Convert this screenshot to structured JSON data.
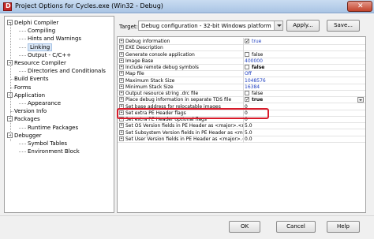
{
  "window": {
    "title": "Project Options for Cycles.exe  (Win32 - Debug)",
    "close_glyph": "✕",
    "icon_glyph": "D"
  },
  "tree": {
    "items": [
      {
        "label": "Delphi Compiler",
        "level": 0,
        "expander": "−"
      },
      {
        "label": "Compiling",
        "level": 1
      },
      {
        "label": "Hints and Warnings",
        "level": 1
      },
      {
        "label": "Linking",
        "level": 1,
        "selected": true
      },
      {
        "label": "Output - C/C++",
        "level": 1
      },
      {
        "label": "Resource Compiler",
        "level": 0,
        "expander": "−"
      },
      {
        "label": "Directories and Conditionals",
        "level": 1
      },
      {
        "label": "Build Events",
        "level": 0
      },
      {
        "label": "Forms",
        "level": 0
      },
      {
        "label": "Application",
        "level": 0,
        "expander": "−"
      },
      {
        "label": "Appearance",
        "level": 1
      },
      {
        "label": "Version Info",
        "level": 0
      },
      {
        "label": "Packages",
        "level": 0,
        "expander": "−"
      },
      {
        "label": "Runtime Packages",
        "level": 1
      },
      {
        "label": "Debugger",
        "level": 0,
        "expander": "−"
      },
      {
        "label": "Symbol Tables",
        "level": 1
      },
      {
        "label": "Environment Block",
        "level": 1
      }
    ]
  },
  "target": {
    "label": "Target:",
    "value": "Debug configuration - 32-bit Windows platform",
    "apply_button": "Apply...",
    "save_button": "Save..."
  },
  "properties": [
    {
      "name": "Debug information",
      "value": "true",
      "check": true,
      "checked": true,
      "style": "blue"
    },
    {
      "name": "EXE Description",
      "value": ""
    },
    {
      "name": "Generate console application",
      "value": "false",
      "check": true,
      "checked": false
    },
    {
      "name": "Image Base",
      "value": "400000",
      "style": "blue"
    },
    {
      "name": "Include remote debug symbols",
      "value": "false",
      "check": true,
      "checked": false,
      "style": "bold"
    },
    {
      "name": "Map file",
      "value": "Off",
      "style": "blue"
    },
    {
      "name": "Maximum Stack Size",
      "value": "1048576",
      "style": "blue"
    },
    {
      "name": "Minimum Stack Size",
      "value": "16384",
      "style": "blue"
    },
    {
      "name": "Output resource string .drc file",
      "value": "false",
      "check": true,
      "checked": false
    },
    {
      "name": "Place debug information in separate TDS file",
      "value": "true",
      "check": true,
      "checked": true,
      "style": "bold",
      "dropdown": true
    },
    {
      "name": "Set base address for relocatable images",
      "value": "0"
    },
    {
      "name": "Set extra PE Header flags",
      "value": "0"
    },
    {
      "name": "Set extra PE Header optional flags",
      "value": "0"
    },
    {
      "name": "Set OS Version fields in PE Header as <major>.<minor>",
      "value": "5.0"
    },
    {
      "name": "Set Subsystem Version fields in PE Header as <major>.<minor>",
      "value": "5.0"
    },
    {
      "name": "Set User Version fields in PE Header as <major>.<minor>",
      "value": "0.0"
    }
  ],
  "expander_glyph": "+",
  "check_glyph": "✓",
  "footer": {
    "ok": "OK",
    "cancel": "Cancel",
    "help": "Help"
  }
}
